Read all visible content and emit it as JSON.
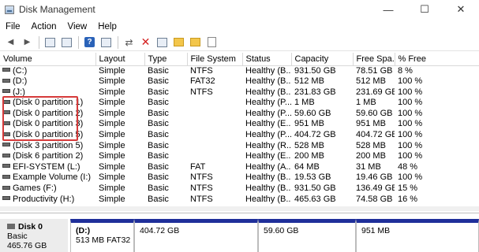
{
  "window": {
    "title": "Disk Management",
    "minimize": "—",
    "maximize": "☐",
    "close": "✕"
  },
  "menu": [
    "File",
    "Action",
    "View",
    "Help"
  ],
  "toolbar": {
    "back": "◀",
    "forward": "▶",
    "connect": "⇄",
    "delete": "✕"
  },
  "table": {
    "headers": [
      "Volume",
      "Layout",
      "Type",
      "File System",
      "Status",
      "Capacity",
      "Free Spa...",
      "% Free"
    ],
    "rows": [
      [
        "(C:)",
        "Simple",
        "Basic",
        "NTFS",
        "Healthy (B...",
        "931.50 GB",
        "78.51 GB",
        "8 %"
      ],
      [
        "(D:)",
        "Simple",
        "Basic",
        "FAT32",
        "Healthy (B...",
        "512 MB",
        "512 MB",
        "100 %"
      ],
      [
        "(J:)",
        "Simple",
        "Basic",
        "NTFS",
        "Healthy (B...",
        "231.83 GB",
        "231.69 GB",
        "100 %"
      ],
      [
        "(Disk 0 partition 1)",
        "Simple",
        "Basic",
        "",
        "Healthy (P...",
        "1 MB",
        "1 MB",
        "100 %"
      ],
      [
        "(Disk 0 partition 2)",
        "Simple",
        "Basic",
        "",
        "Healthy (P...",
        "59.60 GB",
        "59.60 GB",
        "100 %"
      ],
      [
        "(Disk 0 partition 3)",
        "Simple",
        "Basic",
        "",
        "Healthy (E...",
        "951 MB",
        "951 MB",
        "100 %"
      ],
      [
        "(Disk 0 partition 5)",
        "Simple",
        "Basic",
        "",
        "Healthy (P...",
        "404.72 GB",
        "404.72 GB",
        "100 %"
      ],
      [
        "(Disk 3 partition 5)",
        "Simple",
        "Basic",
        "",
        "Healthy (R...",
        "528 MB",
        "528 MB",
        "100 %"
      ],
      [
        "(Disk 6 partition 2)",
        "Simple",
        "Basic",
        "",
        "Healthy (E...",
        "200 MB",
        "200 MB",
        "100 %"
      ],
      [
        "EFI-SYSTEM (L:)",
        "Simple",
        "Basic",
        "FAT",
        "Healthy (A...",
        "64 MB",
        "31 MB",
        "48 %"
      ],
      [
        "Example Volume (I:)",
        "Simple",
        "Basic",
        "NTFS",
        "Healthy (B...",
        "19.53 GB",
        "19.46 GB",
        "100 %"
      ],
      [
        "Games (F:)",
        "Simple",
        "Basic",
        "NTFS",
        "Healthy (B...",
        "931.50 GB",
        "136.49 GB",
        "15 %"
      ],
      [
        "Productivity (H:)",
        "Simple",
        "Basic",
        "NTFS",
        "Healthy (B...",
        "465.63 GB",
        "74.58 GB",
        "16 %"
      ]
    ]
  },
  "disk0": {
    "name": "Disk 0",
    "type": "Basic",
    "size": "465.76 GB",
    "partitions": [
      {
        "name": "(D:)",
        "info": "513 MB FAT32"
      },
      {
        "name": "",
        "info": "404.72 GB"
      },
      {
        "name": "",
        "info": "59.60 GB"
      },
      {
        "name": "",
        "info": "951 MB"
      }
    ]
  }
}
